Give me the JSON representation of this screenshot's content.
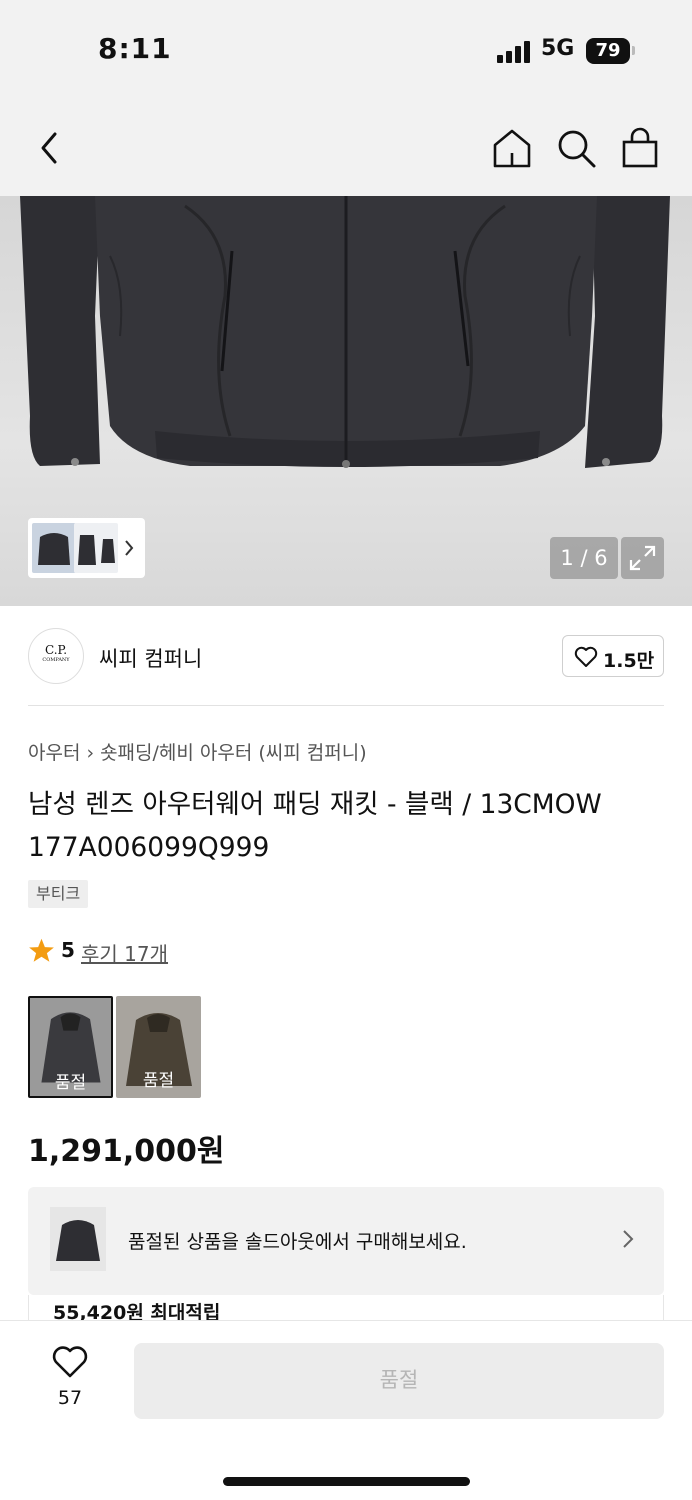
{
  "status": {
    "time": "8:11",
    "network": "5G",
    "battery": "79"
  },
  "nav": {
    "back_icon": "chevron-left-icon",
    "home_icon": "home-icon",
    "search_icon": "search-icon",
    "cart_icon": "shopping-bag-icon"
  },
  "gallery": {
    "counter": "1 / 6",
    "expand_icon": "expand-icon"
  },
  "brand": {
    "logo_line1": "C.P.",
    "logo_line2": "COMPANY",
    "name": "씨피 컴퍼니",
    "likes": "1.5만"
  },
  "breadcrumb": {
    "level1": "아우터",
    "level2": "숏패딩/헤비 아우터 (씨피 컴퍼니)"
  },
  "product": {
    "title": "남성 렌즈 아우터웨어 패딩 재킷 - 블랙 / 13CMOW 177A006099Q999",
    "tag": "부티크",
    "rating": "5",
    "reviews": "후기 17개",
    "price": "1,291,000원"
  },
  "options": [
    {
      "label": "품절",
      "color": "#3a3a3e",
      "selected": true
    },
    {
      "label": "품절",
      "color": "#4a4236",
      "selected": false
    }
  ],
  "soldout_banner": {
    "text": "품절된 상품을 솔드아웃에서 구매해보세요."
  },
  "points": {
    "text": "55,420원 최대적립"
  },
  "bottom": {
    "wish_count": "57",
    "buy_label": "품절"
  }
}
